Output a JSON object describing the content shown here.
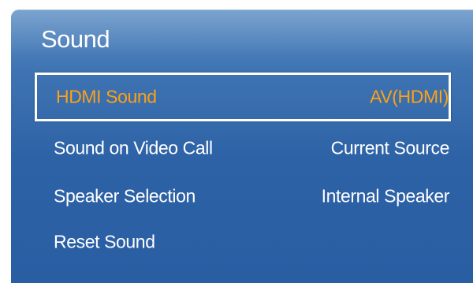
{
  "panel": {
    "title": "Sound",
    "items": [
      {
        "label": "HDMI Sound",
        "value": "AV(HDMI)",
        "selected": true
      },
      {
        "label": "Sound on Video Call",
        "value": "Current Source",
        "selected": false
      },
      {
        "label": "Speaker Selection",
        "value": "Internal Speaker",
        "selected": false
      },
      {
        "label": "Reset Sound",
        "value": "",
        "selected": false
      }
    ]
  },
  "colors": {
    "panel_top": "#5e8fc4",
    "panel_bottom": "#2a5ea3",
    "text": "#ffffff",
    "highlight_text": "#ffa015",
    "focus_border": "#ffffff"
  }
}
